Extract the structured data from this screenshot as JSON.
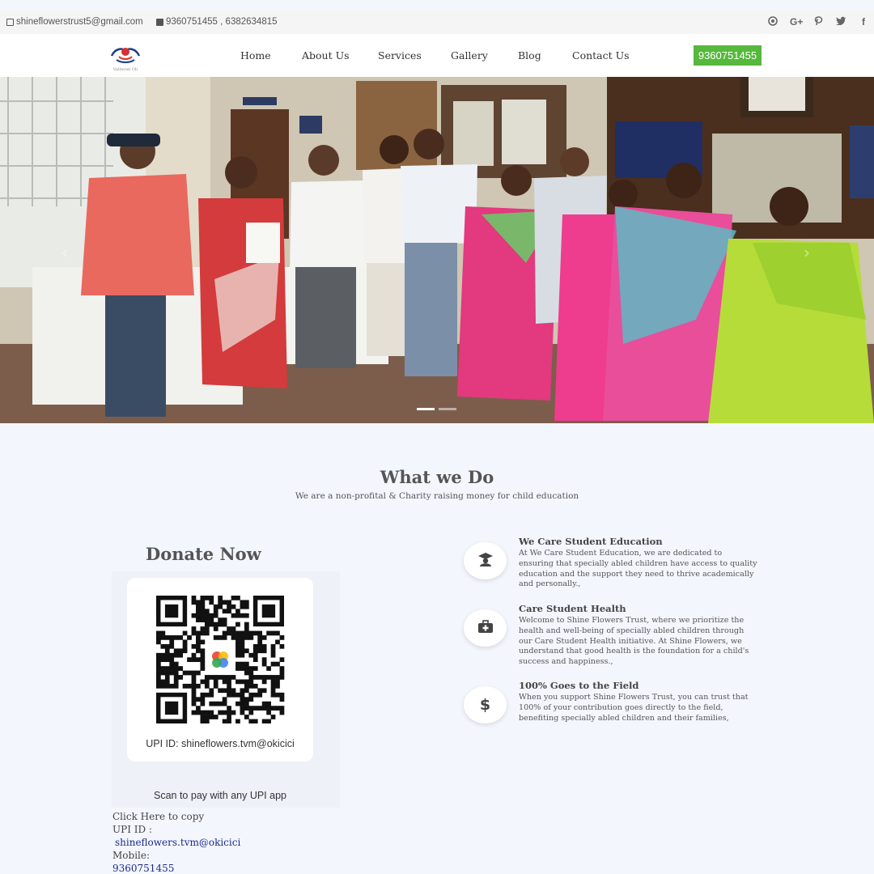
{
  "topbar": {
    "email": "shineflowerstrust5@gmail.com",
    "phones": "9360751455 , 6382634815",
    "social_icons": [
      "github-icon",
      "google-plus-icon",
      "pinterest-icon",
      "twitter-icon",
      "facebook-icon"
    ]
  },
  "nav": {
    "logo_text": "Vallavan Oli",
    "links": [
      "Home",
      "About Us",
      "Services",
      "Gallery",
      "Blog",
      "Contact Us"
    ],
    "call_button": "9360751455"
  },
  "hero": {
    "slides_total": 2,
    "active_slide": 1
  },
  "what_we_do": {
    "title": "What we Do",
    "subtitle": "We are a non-profital & Charity raising money for child education"
  },
  "donate": {
    "title": "Donate Now",
    "upi_caption": "UPI ID: shineflowers.tvm@okicici",
    "scan_text": "Scan to pay with any UPI app",
    "copy_label": "Click Here to copy",
    "upi_label": "UPI ID :",
    "upi_value": "shineflowers.tvm@okicici",
    "mobile_label": "Mobile:",
    "mobile_value": "9360751455"
  },
  "services": [
    {
      "icon": "graduate-icon",
      "title": "We Care Student Education",
      "text": "At We Care Student Education, we are dedicated to ensuring that specially abled children have access to quality education and the support they need to thrive academically and personally.,"
    },
    {
      "icon": "medkit-icon",
      "title": "Care Student Health",
      "text": "Welcome to Shine Flowers Trust, where we prioritize the health and well-being of specially abled children through our Care Student Health initiative. At Shine Flowers, we understand that good health is the foundation for a child's success and happiness.,"
    },
    {
      "icon": "dollar-icon",
      "title": "100% Goes to the Field",
      "text": "When you support Shine Flowers Trust, you can trust that 100% of your contribution goes directly to the field, benefiting specially abled children and their families,"
    }
  ],
  "colors": {
    "accent_green": "#56b83c",
    "link_blue": "#1a2a8c",
    "page_bg": "#f4f6fd"
  }
}
